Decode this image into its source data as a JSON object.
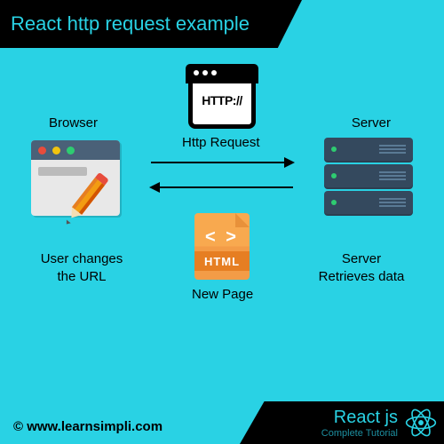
{
  "header": {
    "title": "React http request example"
  },
  "diagram": {
    "browser_label": "Browser",
    "server_label": "Server",
    "http_box_text": "HTTP://",
    "http_request_label": "Http Request",
    "url_change_label": "User changes the URL",
    "server_retrieves_label": "Server Retrieves data",
    "html_brackets": "< >",
    "html_band": "HTML",
    "newpage_label": "New Page"
  },
  "footer": {
    "copyright": "©   www.learnsimpli.com",
    "brand_title": "React js",
    "brand_subtitle": "Complete Tutorial"
  },
  "colors": {
    "bg": "#29d2e4",
    "dark": "#000"
  }
}
